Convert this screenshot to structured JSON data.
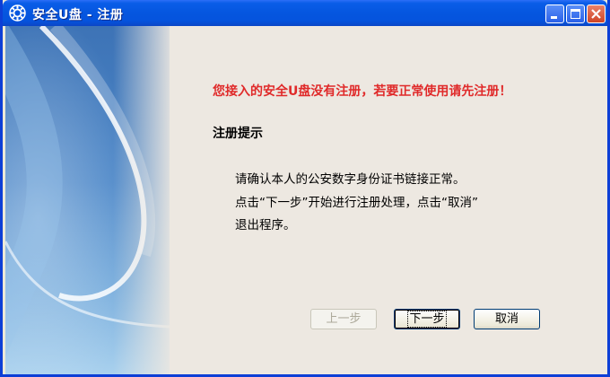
{
  "window": {
    "title": "安全U盘 - 注册",
    "controls": [
      "minimize-icon",
      "maximize-icon",
      "close-icon"
    ],
    "title_color": "#0556df"
  },
  "content": {
    "warning": "您接入的安全U盘没有注册，若要正常使用请先注册！",
    "warning_color": "#e02a2a",
    "heading": "注册提示",
    "lines": [
      "请确认本人的公安数字身份证书链接正常。",
      "点击“下一步”开始进行注册处理，点击“取消”",
      "退出程序。"
    ]
  },
  "buttons": {
    "prev": "上一步",
    "next": "下一步",
    "cancel": "取消"
  }
}
